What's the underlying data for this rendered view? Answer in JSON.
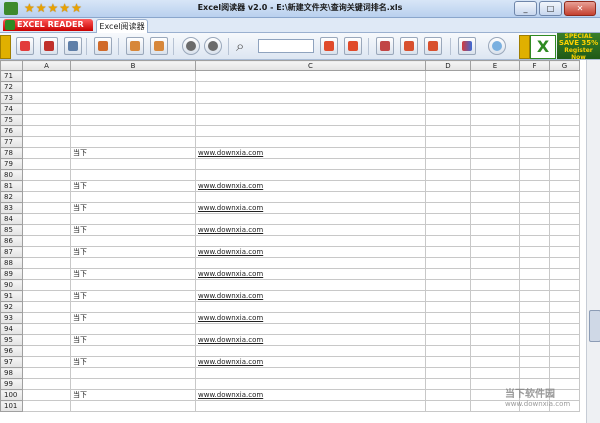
{
  "window": {
    "title": "Excel阅读器 v2.0 - E:\\新建文件夹\\查询关键词排名.xls",
    "rating_stars": 5
  },
  "tabs": {
    "brand": "EXCEL READER",
    "document": "Excel阅读器"
  },
  "promo": {
    "line1": "SPECIAL",
    "line2": "SAVE 35%",
    "line3": "Register Now"
  },
  "sheet": {
    "columns": [
      "A",
      "B",
      "C",
      "D",
      "E",
      "F",
      "G"
    ],
    "rows": [
      {
        "n": "71",
        "b": "",
        "c": ""
      },
      {
        "n": "72",
        "b": "",
        "c": ""
      },
      {
        "n": "73",
        "b": "",
        "c": ""
      },
      {
        "n": "74",
        "b": "",
        "c": ""
      },
      {
        "n": "75",
        "b": "",
        "c": ""
      },
      {
        "n": "76",
        "b": "",
        "c": ""
      },
      {
        "n": "77",
        "b": "",
        "c": ""
      },
      {
        "n": "78",
        "b": "当下",
        "c": "www.downxia.com"
      },
      {
        "n": "79",
        "b": "",
        "c": ""
      },
      {
        "n": "80",
        "b": "",
        "c": ""
      },
      {
        "n": "81",
        "b": "当下",
        "c": "www.downxia.com"
      },
      {
        "n": "82",
        "b": "",
        "c": ""
      },
      {
        "n": "83",
        "b": "当下",
        "c": "www.downxia.com"
      },
      {
        "n": "84",
        "b": "",
        "c": ""
      },
      {
        "n": "85",
        "b": "当下",
        "c": "www.downxia.com"
      },
      {
        "n": "86",
        "b": "",
        "c": ""
      },
      {
        "n": "87",
        "b": "当下",
        "c": "www.downxia.com"
      },
      {
        "n": "88",
        "b": "",
        "c": ""
      },
      {
        "n": "89",
        "b": "当下",
        "c": "www.downxia.com"
      },
      {
        "n": "90",
        "b": "",
        "c": ""
      },
      {
        "n": "91",
        "b": "当下",
        "c": "www.downxia.com"
      },
      {
        "n": "92",
        "b": "",
        "c": ""
      },
      {
        "n": "93",
        "b": "当下",
        "c": "www.downxia.com"
      },
      {
        "n": "94",
        "b": "",
        "c": ""
      },
      {
        "n": "95",
        "b": "当下",
        "c": "www.downxia.com"
      },
      {
        "n": "96",
        "b": "",
        "c": ""
      },
      {
        "n": "97",
        "b": "当下",
        "c": "www.downxia.com"
      },
      {
        "n": "98",
        "b": "",
        "c": ""
      },
      {
        "n": "99",
        "b": "",
        "c": ""
      },
      {
        "n": "100",
        "b": "当下",
        "c": "www.downxia.com"
      },
      {
        "n": "101",
        "b": "",
        "c": ""
      }
    ]
  },
  "watermark": {
    "line1": "当下软件园",
    "line2": "www.downxia.com"
  }
}
